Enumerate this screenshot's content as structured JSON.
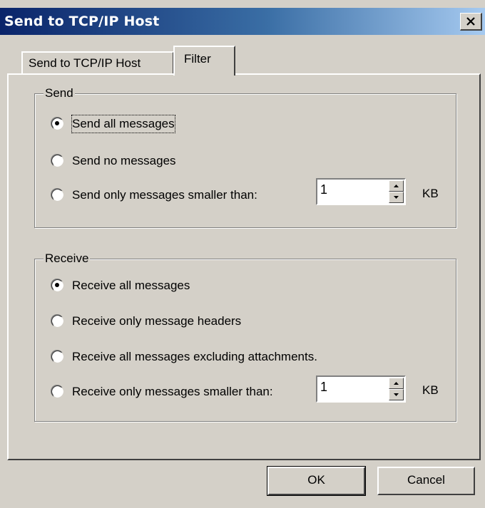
{
  "window": {
    "title": "Send to TCP/IP Host",
    "close_icon": "close-icon"
  },
  "tabs": [
    {
      "label": "Send to TCP/IP Host",
      "active": false
    },
    {
      "label": "Filter",
      "active": true
    }
  ],
  "send_group": {
    "title": "Send",
    "options": [
      {
        "label": "Send all messages",
        "checked": true
      },
      {
        "label": "Send no messages",
        "checked": false
      },
      {
        "label": "Send only messages smaller than:",
        "checked": false
      }
    ],
    "size_value": "1",
    "size_unit": "KB"
  },
  "receive_group": {
    "title": "Receive",
    "options": [
      {
        "label": "Receive all messages",
        "checked": true
      },
      {
        "label": "Receive only message headers",
        "checked": false
      },
      {
        "label": "Receive all messages excluding attachments.",
        "checked": false
      },
      {
        "label": "Receive only messages smaller than:",
        "checked": false
      }
    ],
    "size_value": "1",
    "size_unit": "KB"
  },
  "buttons": {
    "ok": "OK",
    "cancel": "Cancel"
  }
}
